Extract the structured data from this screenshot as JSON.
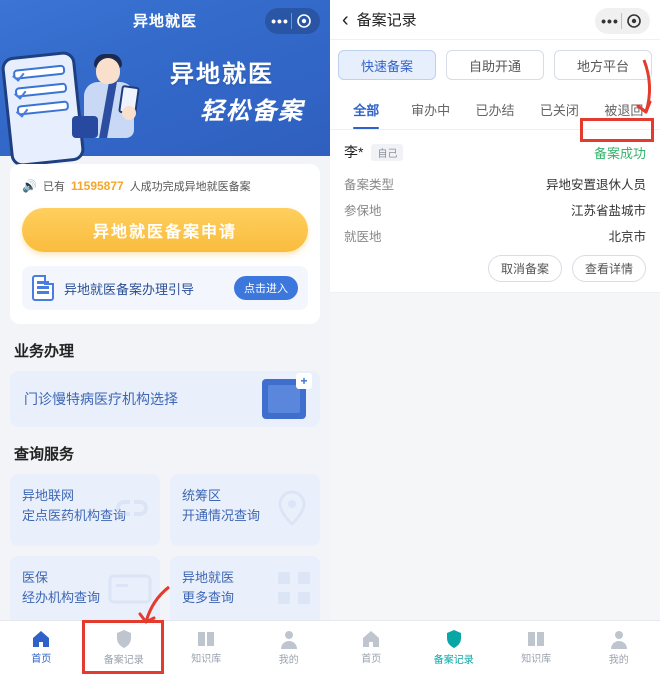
{
  "left": {
    "header_title": "异地就医",
    "hero_line1": "异地就医",
    "hero_line2": "轻松备案",
    "stat_prefix": "已有",
    "stat_number": "11595877",
    "stat_suffix": "人成功完成异地就医备案",
    "apply_button": "异地就医备案申请",
    "guide_text": "异地就医备案办理引导",
    "guide_enter": "点击进入",
    "section_biz": "业务办理",
    "tile_clinic": "门诊慢特病医疗机构选择",
    "section_query": "查询服务",
    "q1a": "异地联网",
    "q1b": "定点医药机构查询",
    "q2a": "统筹区",
    "q2b": "开通情况查询",
    "q3a": "医保",
    "q3b": "经办机构查询",
    "q4a": "异地就医",
    "q4b": "更多查询",
    "tabs": {
      "home": "首页",
      "records": "备案记录",
      "kb": "知识库",
      "mine": "我的"
    }
  },
  "right": {
    "header_title": "备案记录",
    "segments": {
      "quick": "快速备案",
      "self": "自助开通",
      "local": "地方平台"
    },
    "tabs": {
      "all": "全部",
      "ing": "审办中",
      "done": "已办结",
      "closed": "已关闭",
      "reject": "被退回"
    },
    "record": {
      "name": "李*",
      "self_tag": "自己",
      "status": "备案成功",
      "type_label": "备案类型",
      "type_value": "异地安置退休人员",
      "insure_label": "参保地",
      "insure_value": "江苏省盐城市",
      "med_label": "就医地",
      "med_value": "北京市",
      "cancel": "取消备案",
      "detail": "查看详情"
    },
    "tabs_bottom": {
      "home": "首页",
      "records": "备案记录",
      "kb": "知识库",
      "mine": "我的"
    }
  }
}
